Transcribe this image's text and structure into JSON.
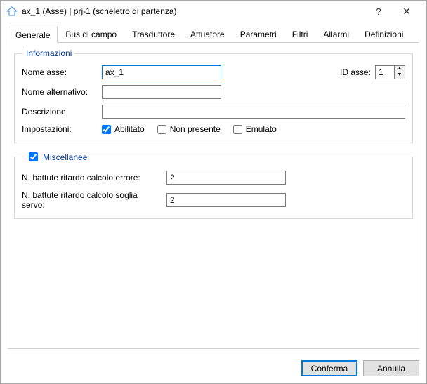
{
  "window": {
    "title": "ax_1 (Asse) | prj-1 (scheletro di partenza)",
    "help": "?",
    "close": "✕"
  },
  "tabs": {
    "generale": "Generale",
    "bus": "Bus di campo",
    "trasduttore": "Trasduttore",
    "attuatore": "Attuatore",
    "parametri": "Parametri",
    "filtri": "Filtri",
    "allarmi": "Allarmi",
    "definizioni": "Definizioni"
  },
  "informazioni": {
    "legend": "Informazioni",
    "nome_asse_label": "Nome asse:",
    "nome_asse_value": "ax_1",
    "id_asse_label": "ID asse:",
    "id_asse_value": "1",
    "nome_alt_label": "Nome alternativo:",
    "nome_alt_value": "",
    "descrizione_label": "Descrizione:",
    "descrizione_value": "",
    "impostazioni_label": "Impostazioni:",
    "abilitato_label": "Abilitato",
    "non_presente_label": "Non presente",
    "emulato_label": "Emulato"
  },
  "miscellanee": {
    "legend": "Miscellanee",
    "battute_errore_label": "N. battute ritardo calcolo errore:",
    "battute_errore_value": "2",
    "battute_soglia_label": "N. battute ritardo calcolo soglia servo:",
    "battute_soglia_value": "2"
  },
  "buttons": {
    "conferma": "Conferma",
    "annulla": "Annulla"
  }
}
